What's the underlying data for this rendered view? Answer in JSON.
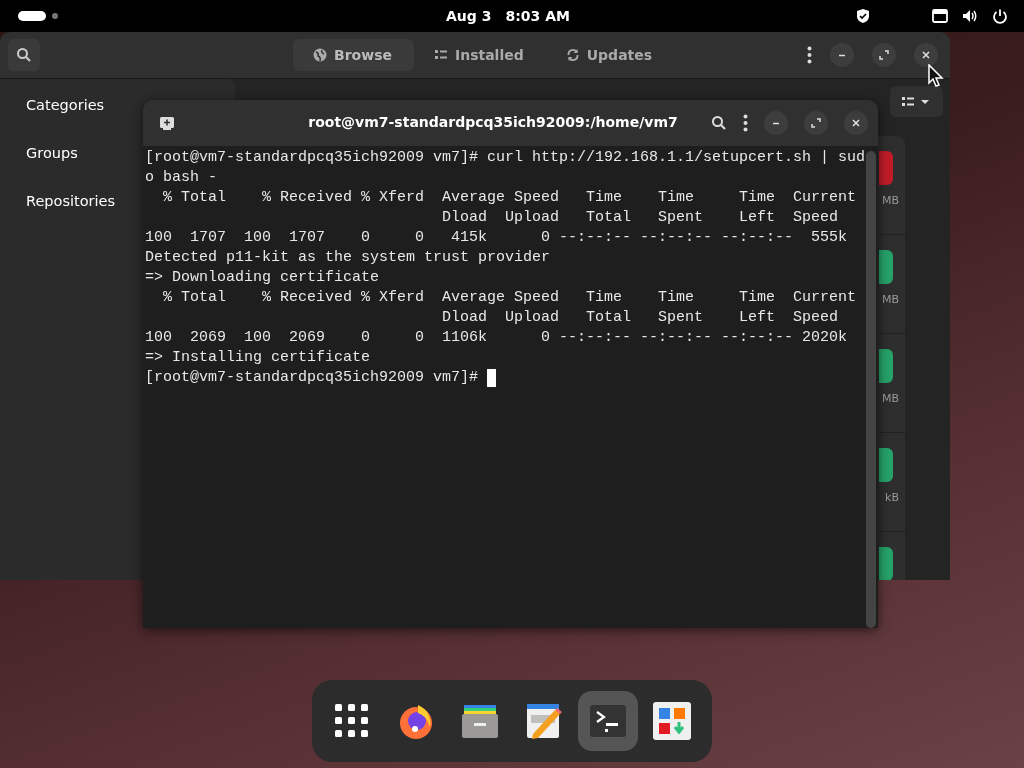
{
  "top_bar": {
    "workspaces": [
      {
        "selected": true
      },
      {
        "selected": false
      }
    ],
    "date": "Aug 3",
    "time": "8:03 AM"
  },
  "software_window": {
    "tabs": [
      {
        "label": "Browse",
        "selected": true,
        "kind": "globe"
      },
      {
        "label": "Installed",
        "selected": false,
        "kind": "list"
      },
      {
        "label": "Updates",
        "selected": false,
        "kind": "refresh"
      }
    ],
    "sidebar": {
      "items": [
        {
          "label": "Categories"
        },
        {
          "label": "Groups"
        },
        {
          "label": "Repositories"
        }
      ]
    },
    "app_list": [
      {
        "color": "#c01c28",
        "size": "MB"
      },
      {
        "color": "#26a269",
        "size": "MB"
      },
      {
        "color": "#26a269",
        "size": "MB"
      },
      {
        "color": "#26a269",
        "size": "kB"
      },
      {
        "color": "#26a269"
      }
    ]
  },
  "terminal_window": {
    "title": "root@vm7-standardpcq35ich92009:/home/vm7",
    "lines": [
      "[root@vm7-standardpcq35ich92009 vm7]# curl http://192.168.1.1/setupcert.sh | sud",
      "o bash -",
      "  % Total    % Received % Xferd  Average Speed   Time    Time     Time  Current",
      "                                 Dload  Upload   Total   Spent    Left  Speed",
      "100  1707  100  1707    0     0   415k      0 --:--:-- --:--:-- --:--:--  555k",
      "Detected p11-kit as the system trust provider",
      "=> Downloading certificate",
      "  % Total    % Received % Xferd  Average Speed   Time    Time     Time  Current",
      "                                 Dload  Upload   Total   Spent    Left  Speed",
      "100  2069  100  2069    0     0  1106k      0 --:--:-- --:--:-- --:--:-- 2020k",
      "=> Installing certificate",
      "[root@vm7-standardpcq35ich92009 vm7]# "
    ]
  },
  "dock": [
    {
      "kind": "apps",
      "selected": false
    },
    {
      "kind": "browser",
      "selected": false
    },
    {
      "kind": "files",
      "selected": false
    },
    {
      "kind": "editor",
      "selected": false
    },
    {
      "kind": "terminal",
      "selected": true
    },
    {
      "kind": "store",
      "selected": false
    }
  ]
}
